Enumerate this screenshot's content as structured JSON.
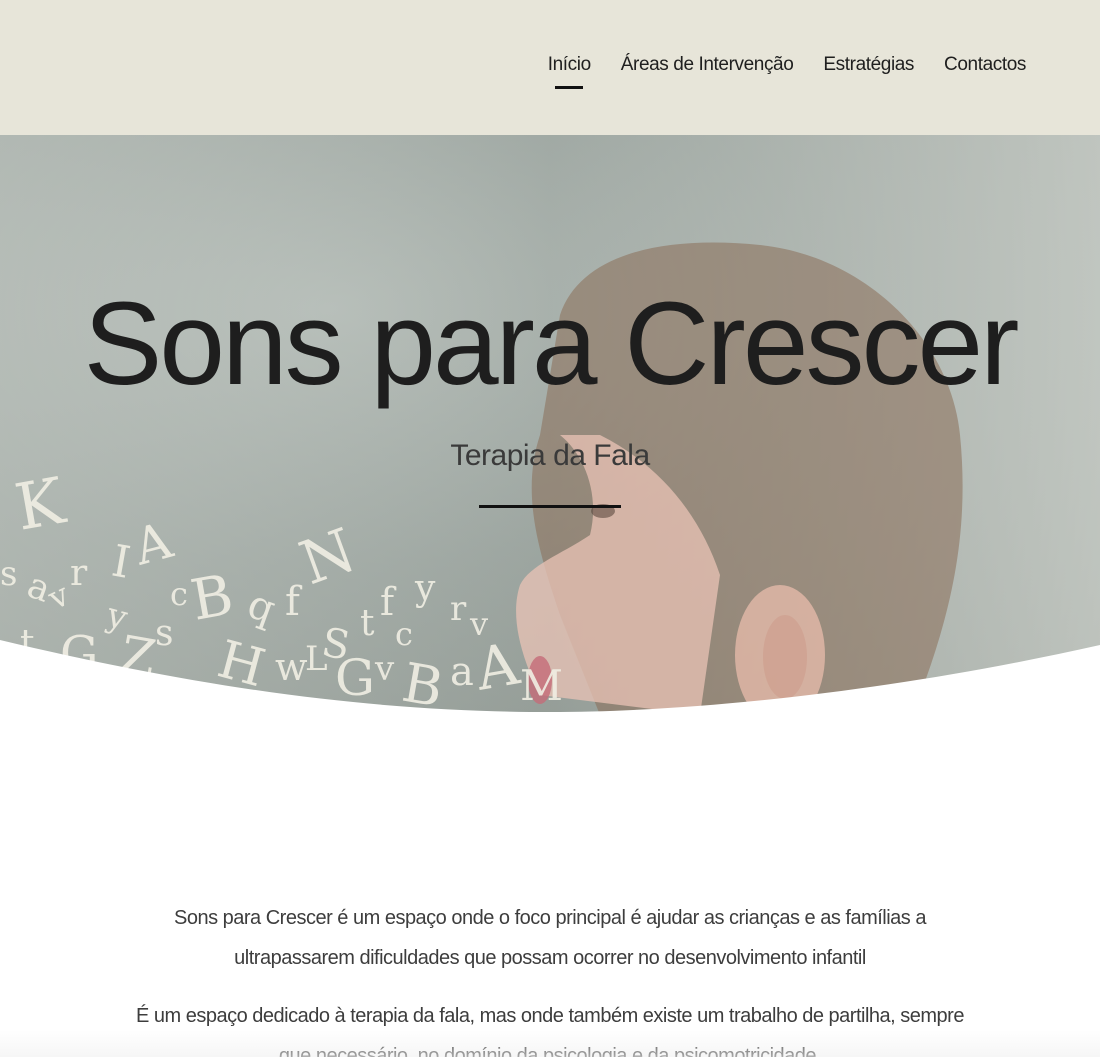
{
  "nav": {
    "items": [
      {
        "label": "Início",
        "active": true
      },
      {
        "label": "Áreas de Intervenção",
        "active": false
      },
      {
        "label": "Estratégias",
        "active": false
      },
      {
        "label": "Contactos",
        "active": false
      }
    ]
  },
  "hero": {
    "title": "Sons para Crescer",
    "subtitle": "Terapia da Fala"
  },
  "intro": {
    "paragraph_1": "Sons para Crescer é um espaço onde o foco principal é ajudar as crianças e as famílias a ultrapassarem dificuldades que possam ocorrer no desenvolvimento infantil",
    "paragraph_2": "É um espaço dedicado à terapia da fala, mas onde também existe um trabalho de partilha, sempre que necessário, no domínio da psicologia e da psicomotricidade."
  },
  "colors": {
    "header_bg": "#e7e5d9",
    "accent": "#111111"
  }
}
